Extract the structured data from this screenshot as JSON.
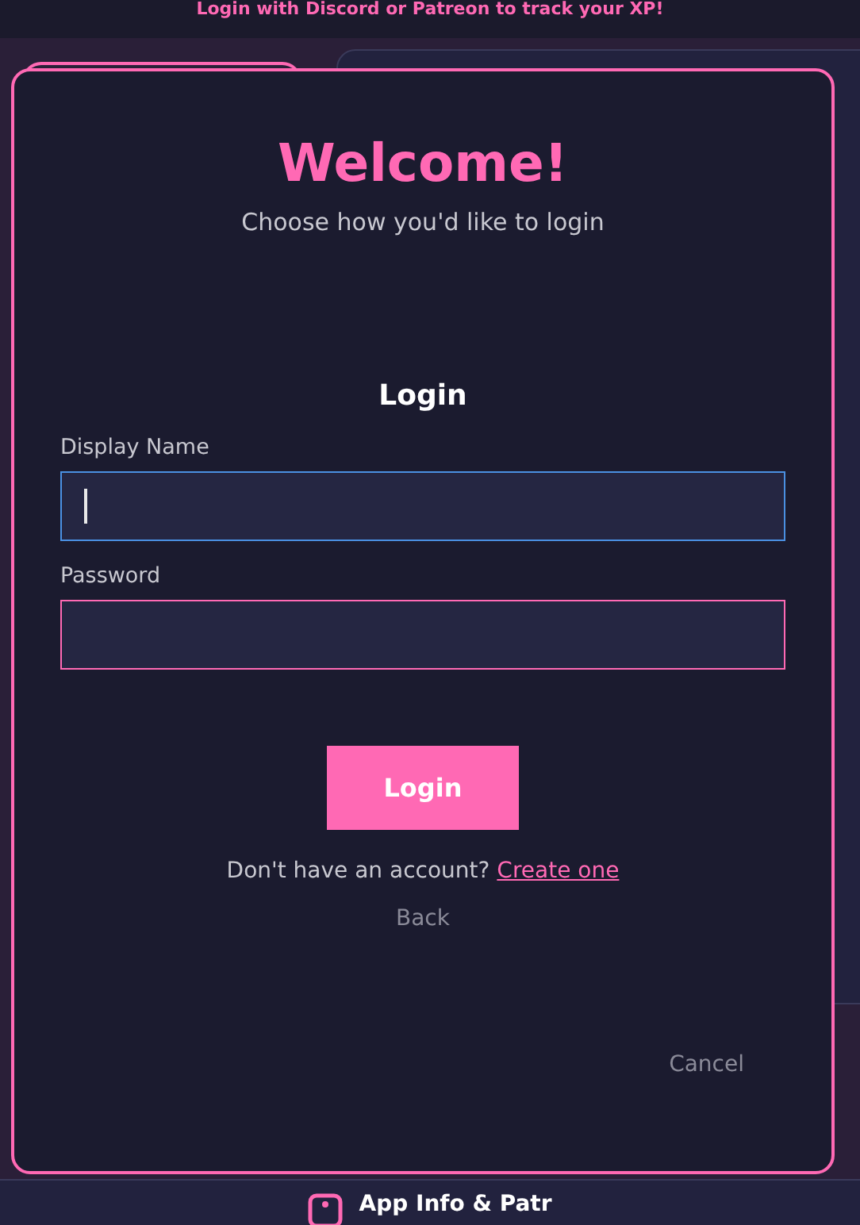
{
  "banner": {
    "text": "Login with Discord or Patreon to track your XP!"
  },
  "modal": {
    "title": "Welcome!",
    "subtitle": "Choose how you'd like to login",
    "heading": "Login",
    "fields": [
      {
        "label": "Display Name",
        "focused": true
      },
      {
        "label": "Password",
        "focused": false
      }
    ],
    "submit": "Login",
    "signup_prompt": "Don't have an account?",
    "signup_link": "Create one",
    "back": "Back",
    "cancel": "Cancel"
  },
  "footer": {
    "text": "App Info & Patr"
  }
}
